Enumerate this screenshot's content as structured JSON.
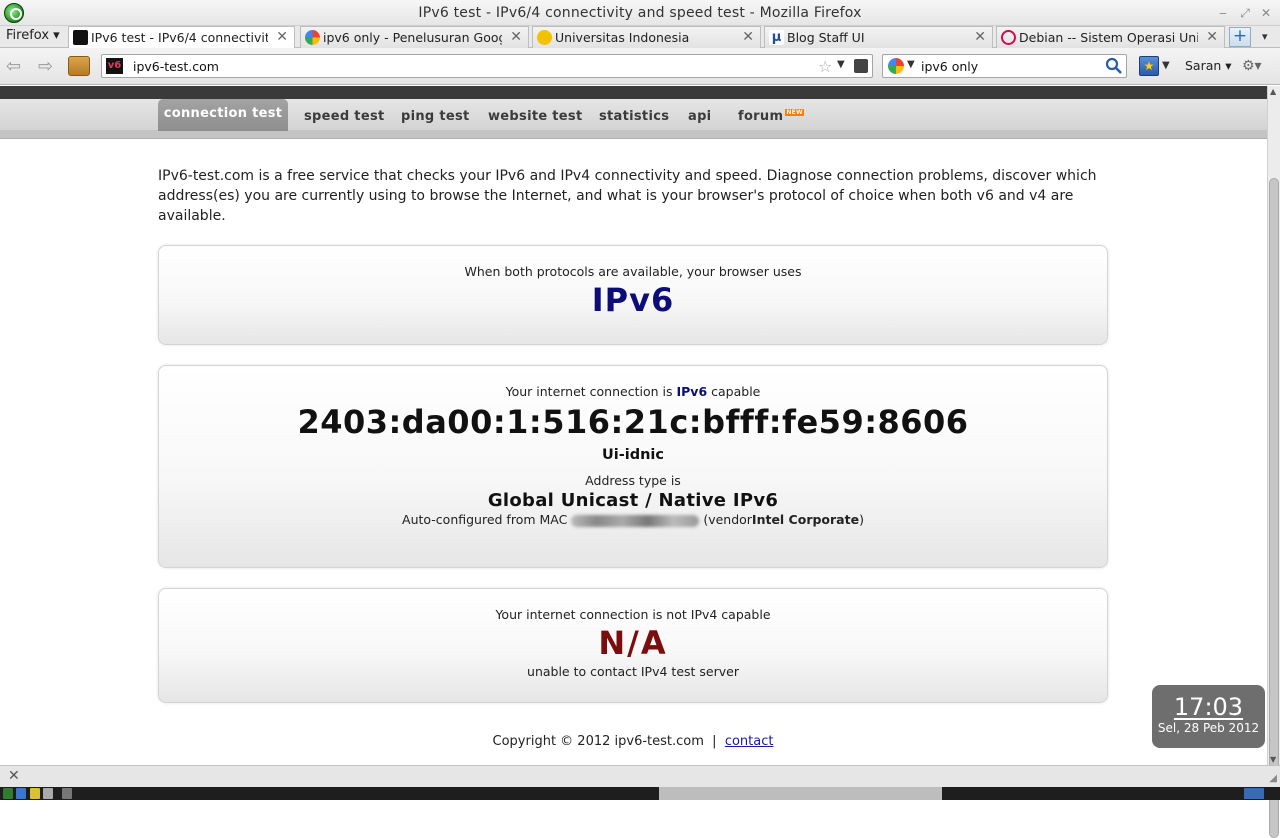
{
  "window": {
    "title": "IPv6 test - IPv6/4 connectivity and speed test - Mozilla Firefox",
    "minimize": "‒",
    "maximize": "⤢",
    "close": "✕"
  },
  "tabstrip": {
    "menu_label": "Firefox ▾",
    "tabs": [
      {
        "label": "IPv6 test - IPv6/4 connectivity ...",
        "favicon_color": "#111111"
      },
      {
        "label": "ipv6 only - Penelusuran Google",
        "favicon_color": "#4285f4"
      },
      {
        "label": "Universitas Indonesia",
        "favicon_color": "#f2c200"
      },
      {
        "label": "Blog Staff UI",
        "favicon_color": "#1f4fa8"
      },
      {
        "label": "Debian -- Sistem Operasi Univ...",
        "favicon_color": "#d70751"
      }
    ],
    "close_glyph": "✕",
    "new_tab": "+",
    "more": "▾"
  },
  "navbar": {
    "back": "⇦",
    "forward": "⇨",
    "url": "ipv6-test.com",
    "site_icon": "v6",
    "search_query": "ipv6 only",
    "saran_label": "Saran ▾"
  },
  "site": {
    "nav": [
      {
        "label": "connection test"
      },
      {
        "label": "speed test"
      },
      {
        "label": "ping test"
      },
      {
        "label": "website test"
      },
      {
        "label": "statistics"
      },
      {
        "label": "api"
      },
      {
        "label": "forum"
      }
    ],
    "new_badge": "NEW",
    "intro": "IPv6-test.com is a free service that checks your IPv6 and IPv4 connectivity and speed. Diagnose connection problems, discover which address(es) you are currently using to browse the Internet, and what is your browser's protocol of choice when both v6 and v4 are available.",
    "preference": {
      "text": "When both protocols are available, your browser uses",
      "value": "IPv6"
    },
    "ipv6": {
      "capable_prefix": "Your internet connection is",
      "capable_proto": "IPv6",
      "capable_suffix": "capable",
      "address": "2403:da00:1:516:21c:bfff:fe59:8606",
      "hostname": "Ui-idnic",
      "type_label": "Address type is",
      "type_value": "Global Unicast / Native IPv6",
      "autoconf_prefix": "Auto-configured from MAC",
      "vendor_prefix": "(vendor",
      "vendor_name": "Intel Corporate",
      "vendor_suffix": ")"
    },
    "ipv4": {
      "status": "Your internet connection is not IPv4 capable",
      "value": "N/A",
      "note": "unable to contact IPv4 test server"
    },
    "footer": {
      "copyright": "Copyright © 2012 ipv6-test.com",
      "separator": "|",
      "contact": "contact"
    }
  },
  "clock": {
    "time": "17:03",
    "date": "Sel, 28 Peb 2012"
  },
  "colors": {
    "ipv6_blue": "#0d0d7a",
    "na_red": "#7a0d0d",
    "link": "#1a1aa8"
  }
}
